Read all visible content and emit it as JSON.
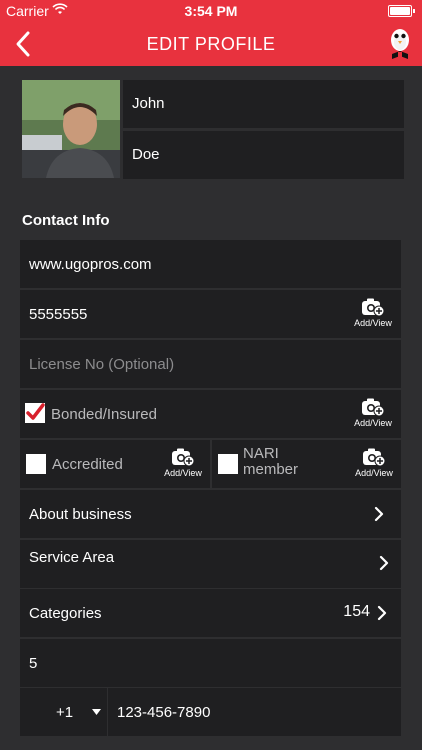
{
  "status": {
    "carrier": "Carrier",
    "time": "3:54 PM"
  },
  "nav": {
    "title": "EDIT PROFILE"
  },
  "profile": {
    "first_name": "John",
    "last_name": "Doe"
  },
  "section": {
    "contact_title": "Contact Info"
  },
  "fields": {
    "website": "www.ugopros.com",
    "phone_main": "5555555",
    "license_placeholder": "License No (Optional)",
    "bonded_label": "Bonded/Insured",
    "bonded_checked": true,
    "accredited_label": "Accredited",
    "accredited_checked": false,
    "nari_label_line1": "NARI",
    "nari_label_line2": "member",
    "nari_checked": false,
    "add_view": "Add/View",
    "about_business": "About business",
    "service_area": "Service Area",
    "categories_label": "Categories",
    "categories_count": "154",
    "number_value": "5",
    "country_code": "+1",
    "phone_number": "123-456-7890"
  },
  "icons": {
    "back": "chevron-left-icon",
    "mascot": "mascot-logo-icon",
    "camera": "camera-plus-icon",
    "chevron": "chevron-right-icon",
    "dropdown": "caret-down-icon",
    "check": "checkmark-icon"
  },
  "colors": {
    "brand": "#e8323e",
    "row_bg": "#1f1f21",
    "page_bg": "#2e2e30"
  }
}
